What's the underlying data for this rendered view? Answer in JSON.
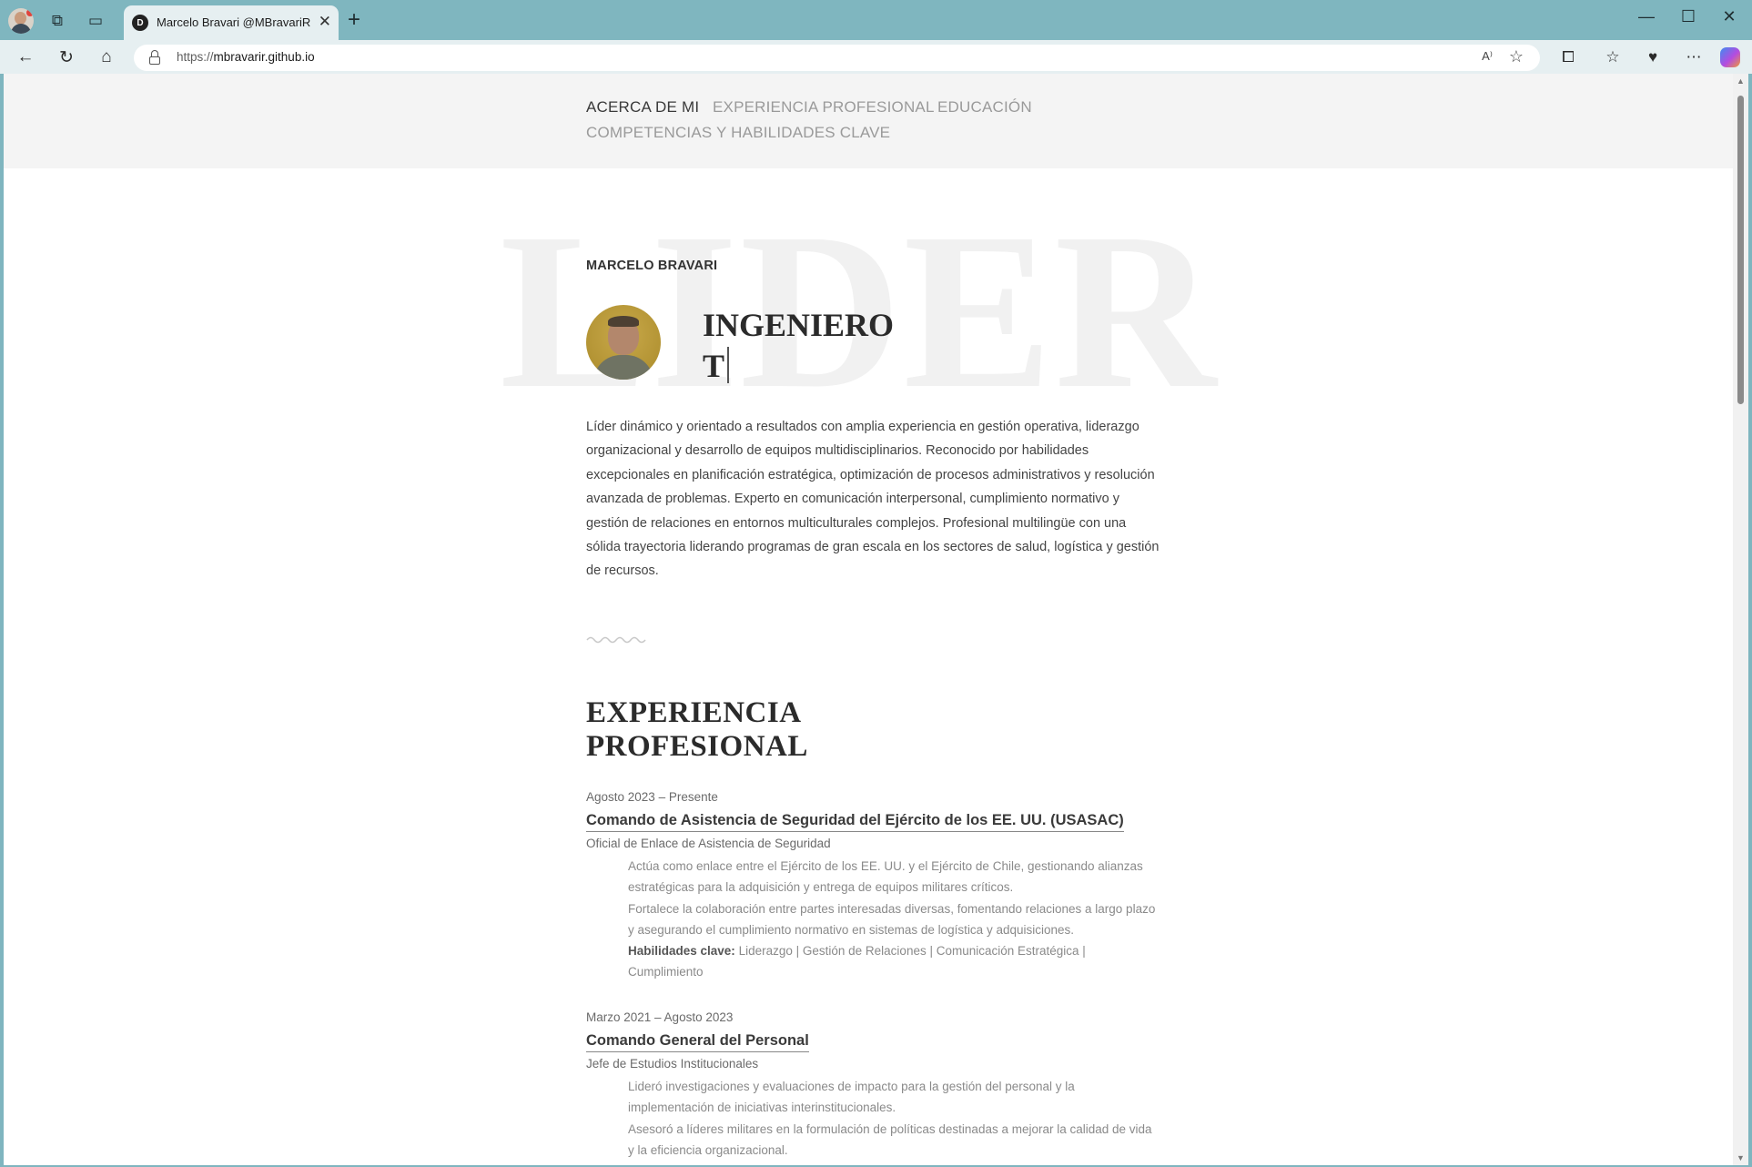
{
  "browser": {
    "tab_title": "Marcelo Bravari @MBravariR",
    "tab_favicon_letter": "D",
    "url_protocol": "https://",
    "url_host": "mbravarir.github.io",
    "read_aloud_label": "A⁾"
  },
  "nav": {
    "items": [
      "ACERCA DE MI",
      "EXPERIENCIA PROFESIONAL",
      "EDUCACIÓN",
      "COMPETENCIAS Y HABILIDADES CLAVE"
    ],
    "active": "ACERCA DE MI"
  },
  "hero": {
    "watermark": "LIDER",
    "name": "MARCELO BRAVARI",
    "headline_line1": "INGENIERO",
    "headline_line2": "T",
    "intro": "Líder dinámico y orientado a resultados con amplia experiencia en gestión operativa, liderazgo organizacional y desarrollo de equipos multidisciplinarios. Reconocido por habilidades excepcionales en planificación estratégica, optimización de procesos administrativos y resolución avanzada de problemas. Experto en comunicación interpersonal, cumplimiento normativo y gestión de relaciones en entornos multiculturales complejos. Profesional multilingüe con una sólida trayectoria liderando programas de gran escala en los sectores de salud, logística y gestión de recursos."
  },
  "experience": {
    "title_line1": "EXPERIENCIA",
    "title_line2": "PROFESIONAL",
    "jobs": [
      {
        "date": "Agosto 2023 – Presente",
        "company": "Comando de Asistencia de Seguridad del Ejército de los EE. UU. (USASAC)",
        "role": "Oficial de Enlace de Asistencia de Seguridad",
        "bullets": [
          "Actúa como enlace entre el Ejército de los EE. UU. y el Ejército de Chile, gestionando alianzas estratégicas para la adquisición y entrega de equipos militares críticos.",
          "Fortalece la colaboración entre partes interesadas diversas, fomentando relaciones a largo plazo y asegurando el cumplimiento normativo en sistemas de logística y adquisiciones."
        ],
        "skills_label": "Habilidades clave:",
        "skills": "Liderazgo | Gestión de Relaciones | Comunicación Estratégica | Cumplimiento"
      },
      {
        "date": "Marzo 2021 – Agosto 2023",
        "company": "Comando General del Personal",
        "role": "Jefe de Estudios Institucionales",
        "bullets": [
          "Lideró investigaciones y evaluaciones de impacto para la gestión del personal y la implementación de iniciativas interinstitucionales.",
          "Asesoró a líderes militares en la formulación de políticas destinadas a mejorar la calidad de vida y la eficiencia organizacional."
        ]
      }
    ]
  },
  "colors": {
    "browser_frame": "#7fb6bf",
    "header_bg": "#f4f4f4",
    "nav_active": "#3a3a3a",
    "nav_inactive": "#9a9a9a",
    "watermark": "#f1f1f1"
  }
}
